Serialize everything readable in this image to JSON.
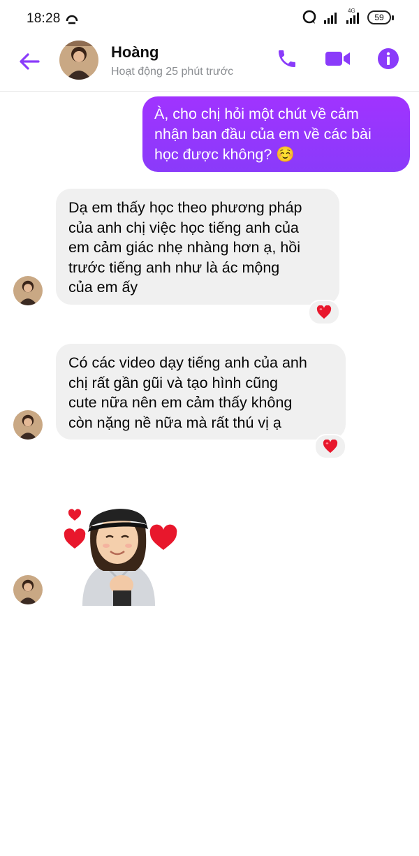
{
  "status_bar": {
    "time": "18:28",
    "network": "4G",
    "battery": "59"
  },
  "header": {
    "name": "Hoàng",
    "activity": "Hoạt động 25 phút trước",
    "accent": "#8a3bfa"
  },
  "messages": [
    {
      "direction": "outgoing",
      "lines": [
        "À, cho chị hỏi một chút về cảm",
        "nhận ban đầu của em về các bài",
        "học được không? ☺️"
      ]
    },
    {
      "direction": "incoming",
      "lines": [
        "Dạ em thấy học theo phương pháp",
        "của anh chị việc học tiếng anh của",
        "em cảm giác nhẹ nhàng hơn ạ, hồi",
        "trước tiếng anh như là ác mộng",
        "của em ấy"
      ],
      "reaction": "❤️"
    },
    {
      "direction": "incoming",
      "lines": [
        "Có các video dạy tiếng anh của anh",
        "chị rất gần gũi và tạo hình cũng",
        "cute nữa nên em cảm thấy không",
        "còn nặng nề nữa mà rất thú vị ạ"
      ],
      "reaction": "❤️"
    },
    {
      "direction": "incoming",
      "type": "sticker",
      "sticker": "avatar-hearts-sticker"
    }
  ]
}
